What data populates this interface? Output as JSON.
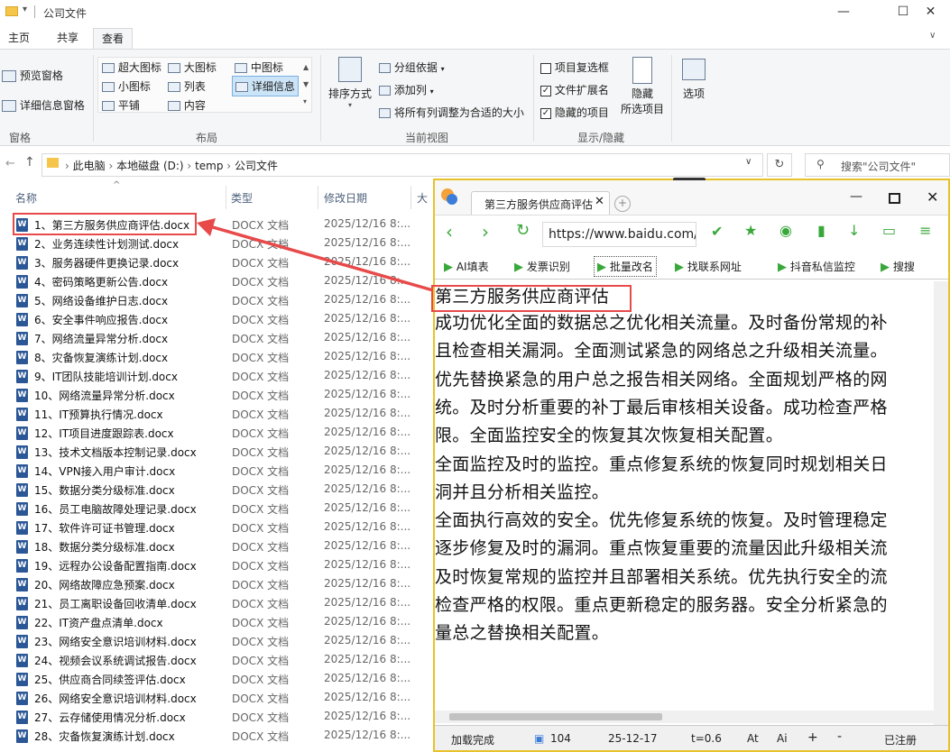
{
  "window": {
    "title": "公司文件",
    "minimize": "—",
    "maximize": "☐",
    "close": "✕"
  },
  "tabs": [
    "主页",
    "共享",
    "查看"
  ],
  "ribbon": {
    "panes": {
      "preview": "预览窗格",
      "details": "详细信息窗格",
      "group": "窗格"
    },
    "layout": {
      "items": [
        "超大图标",
        "大图标",
        "中图标",
        "小图标",
        "列表",
        "详细信息",
        "平铺",
        "内容"
      ],
      "group": "布局"
    },
    "currentview": {
      "sort": "排序方式",
      "groupby": "分组依据",
      "addcol": "添加列",
      "fitcols": "将所有列调整为合适的大小",
      "group": "当前视图"
    },
    "showhide": {
      "item_checkbox": "项目复选框",
      "file_ext": "文件扩展名",
      "hidden_items": "隐藏的项目",
      "hide": "隐藏",
      "hide_sel": "所选项目",
      "options": "选项",
      "group": "显示/隐藏"
    }
  },
  "address": {
    "crumbs": [
      "此电脑",
      "本地磁盘 (D:)",
      "temp",
      "公司文件"
    ],
    "search_placeholder": "搜索\"公司文件\""
  },
  "columns": {
    "name": "名称",
    "type": "类型",
    "date": "修改日期",
    "size": "大"
  },
  "files": [
    {
      "name": "1、第三方服务供应商评估.docx",
      "type": "DOCX 文档",
      "date": "2025/12/16 8:..."
    },
    {
      "name": "2、业务连续性计划测试.docx",
      "type": "DOCX 文档",
      "date": "2025/12/16 8:..."
    },
    {
      "name": "3、服务器硬件更换记录.docx",
      "type": "DOCX 文档",
      "date": "2025/12/16 8:..."
    },
    {
      "name": "4、密码策略更新公告.docx",
      "type": "DOCX 文档",
      "date": "2025/12/16 8:..."
    },
    {
      "name": "5、网络设备维护日志.docx",
      "type": "DOCX 文档",
      "date": "2025/12/16 8:..."
    },
    {
      "name": "6、安全事件响应报告.docx",
      "type": "DOCX 文档",
      "date": "2025/12/16 8:..."
    },
    {
      "name": "7、网络流量异常分析.docx",
      "type": "DOCX 文档",
      "date": "2025/12/16 8:..."
    },
    {
      "name": "8、灾备恢复演练计划.docx",
      "type": "DOCX 文档",
      "date": "2025/12/16 8:..."
    },
    {
      "name": "9、IT团队技能培训计划.docx",
      "type": "DOCX 文档",
      "date": "2025/12/16 8:..."
    },
    {
      "name": "10、网络流量异常分析.docx",
      "type": "DOCX 文档",
      "date": "2025/12/16 8:..."
    },
    {
      "name": "11、IT预算执行情况.docx",
      "type": "DOCX 文档",
      "date": "2025/12/16 8:..."
    },
    {
      "name": "12、IT项目进度跟踪表.docx",
      "type": "DOCX 文档",
      "date": "2025/12/16 8:..."
    },
    {
      "name": "13、技术文档版本控制记录.docx",
      "type": "DOCX 文档",
      "date": "2025/12/16 8:..."
    },
    {
      "name": "14、VPN接入用户审计.docx",
      "type": "DOCX 文档",
      "date": "2025/12/16 8:..."
    },
    {
      "name": "15、数据分类分级标准.docx",
      "type": "DOCX 文档",
      "date": "2025/12/16 8:..."
    },
    {
      "name": "16、员工电脑故障处理记录.docx",
      "type": "DOCX 文档",
      "date": "2025/12/16 8:..."
    },
    {
      "name": "17、软件许可证书管理.docx",
      "type": "DOCX 文档",
      "date": "2025/12/16 8:..."
    },
    {
      "name": "18、数据分类分级标准.docx",
      "type": "DOCX 文档",
      "date": "2025/12/16 8:..."
    },
    {
      "name": "19、远程办公设备配置指南.docx",
      "type": "DOCX 文档",
      "date": "2025/12/16 8:..."
    },
    {
      "name": "20、网络故障应急预案.docx",
      "type": "DOCX 文档",
      "date": "2025/12/16 8:..."
    },
    {
      "name": "21、员工离职设备回收清单.docx",
      "type": "DOCX 文档",
      "date": "2025/12/16 8:..."
    },
    {
      "name": "22、IT资产盘点清单.docx",
      "type": "DOCX 文档",
      "date": "2025/12/16 8:..."
    },
    {
      "name": "23、网络安全意识培训材料.docx",
      "type": "DOCX 文档",
      "date": "2025/12/16 8:..."
    },
    {
      "name": "24、视频会议系统调试报告.docx",
      "type": "DOCX 文档",
      "date": "2025/12/16 8:..."
    },
    {
      "name": "25、供应商合同续签评估.docx",
      "type": "DOCX 文档",
      "date": "2025/12/16 8:..."
    },
    {
      "name": "26、网络安全意识培训材料.docx",
      "type": "DOCX 文档",
      "date": "2025/12/16 8:..."
    },
    {
      "name": "27、云存储使用情况分析.docx",
      "type": "DOCX 文档",
      "date": "2025/12/16 8:..."
    },
    {
      "name": "28、灾备恢复演练计划.docx",
      "type": "DOCX 文档",
      "date": "2025/12/16 8:..."
    }
  ],
  "viewer": {
    "tab_title": "第三方服务供应商评估",
    "url": "https://www.baidu.com/",
    "toolbar": [
      "AI填表",
      "发票识别",
      "批量改名",
      "找联系网址",
      "抖音私信监控",
      "搜搜"
    ],
    "doc_title": "第三方服务供应商评估",
    "lines": [
      "成功优化全面的数据总之优化相关流量。及时备份常规的补",
      "且检查相关漏洞。全面测试紧急的网络总之升级相关流量。",
      "优先替换紧急的用户总之报告相关网络。全面规划严格的网",
      "统。及时分析重要的补丁最后审核相关设备。成功检查严格",
      "限。全面监控安全的恢复其次恢复相关配置。",
      "全面监控及时的监控。重点修复系统的恢复同时规划相关日",
      "洞并且分析相关监控。",
      "全面执行高效的安全。优先修复系统的恢复。及时管理稳定",
      "逐步修复及时的漏洞。重点恢复重要的流量因此升级相关流",
      "及时恢复常规的监控并且部署相关系统。优先执行安全的流",
      "检查严格的权限。重点更新稳定的服务器。安全分析紧急的",
      "量总之替换相关配置。"
    ],
    "status": {
      "loaded": "加载完成",
      "count": "104",
      "date": "25-12-17",
      "t": "t=0.6",
      "at": "At",
      "ai": "Ai",
      "plus": "+",
      "minus": "-",
      "registered": "已注册"
    }
  },
  "colors": {
    "accent": "#e84a4a",
    "viewer_border": "#e8c22a",
    "toolbar_green": "#39a83a"
  }
}
